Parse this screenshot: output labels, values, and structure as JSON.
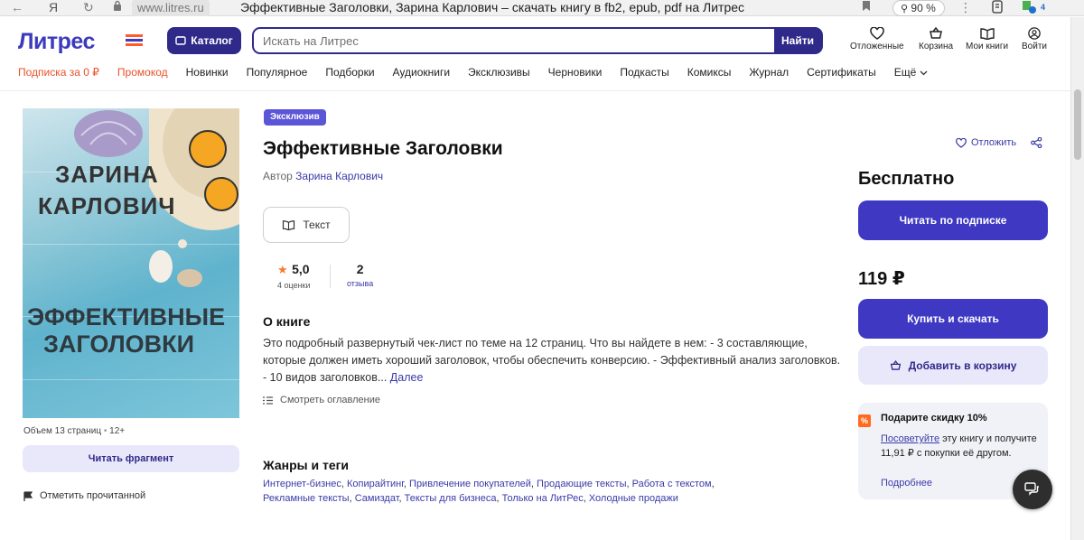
{
  "browser": {
    "url_domain": "www.litres.ru",
    "page_title": "Эффективные Заголовки, Зарина Карлович – скачать книгу в fb2, epub, pdf на Литрес",
    "zoom": "90 %",
    "yandex_glyph": "Я",
    "extension_badge": "4"
  },
  "header": {
    "logo_text": "Литрес",
    "catalog_label": "Каталог",
    "search_placeholder": "Искать на Литрес",
    "search_button": "Найти",
    "icons": [
      {
        "label": "Отложенные",
        "icon": "heart-icon"
      },
      {
        "label": "Корзина",
        "icon": "cart-icon"
      },
      {
        "label": "Мои книги",
        "icon": "book-icon"
      },
      {
        "label": "Войти",
        "icon": "user-icon"
      }
    ]
  },
  "nav": {
    "items": [
      "Подписка за 0 ₽",
      "Промокод",
      "Новинки",
      "Популярное",
      "Подборки",
      "Аудиокниги",
      "Эксклюзивы",
      "Черновики",
      "Подкасты",
      "Комиксы",
      "Журнал",
      "Сертификаты",
      "Ещё"
    ],
    "accent": "#e8512a"
  },
  "cover": {
    "author_line1": "ЗАРИНА",
    "author_line2": "КАРЛОВИЧ",
    "title_line1": "ЭФФЕКТИВНЫЕ",
    "title_line2": "ЗАГОЛОВКИ"
  },
  "left": {
    "volume": "Объем 13 страниц",
    "age": "12+",
    "read_fragment": "Читать фрагмент",
    "mark_read": "Отметить прочитанной"
  },
  "book": {
    "badge": "Эксклюзив",
    "title": "Эффективные Заголовки",
    "author_prefix": "Автор",
    "author": "Зарина Карлович",
    "format_button": "Текст",
    "rating": "5,0",
    "rating_count": "4 оценки",
    "reviews": "2",
    "reviews_label": "отзыва",
    "about_heading": "О книге",
    "about_text": "Это подробный развернутый чек-лист по теме на 12 страниц. Что вы найдете в нем: - 3 составляющие, которые должен иметь хороший заголовок, чтобы обеспечить конверсию. - Эффективный анализ заголовков. - 10 видов заголовков...",
    "more_link": "Далее",
    "toc_link": "Смотреть оглавление",
    "genres_heading": "Жанры и теги",
    "genres": [
      "Интернет-бизнес",
      "Копирайтинг",
      "Привлечение покупателей",
      "Продающие тексты",
      "Работа с текстом",
      "Рекламные тексты",
      "Самиздат",
      "Тексты для бизнеса",
      "Только на ЛитРес",
      "Холодные продажи"
    ]
  },
  "purchase": {
    "defer": "Отложить",
    "free_label": "Бесплатно",
    "subscribe_button": "Читать по подписке",
    "price": "119 ₽",
    "buy_button": "Купить и скачать",
    "add_to_cart": "Добавить в корзину",
    "promo_pct": "%",
    "promo_title": "Подарите скидку 10%",
    "promo_link": "Посоветуйте",
    "promo_text": " эту книгу и получите 11,91 ₽ с покупки её другом.",
    "promo_more": "Подробнее"
  },
  "colors": {
    "brand": "#3d3bbd",
    "primary_button": "#3e38c3",
    "dark_navy": "#2f2a8a",
    "badge": "#5b55d8",
    "light_button": "#e9e8fb"
  }
}
